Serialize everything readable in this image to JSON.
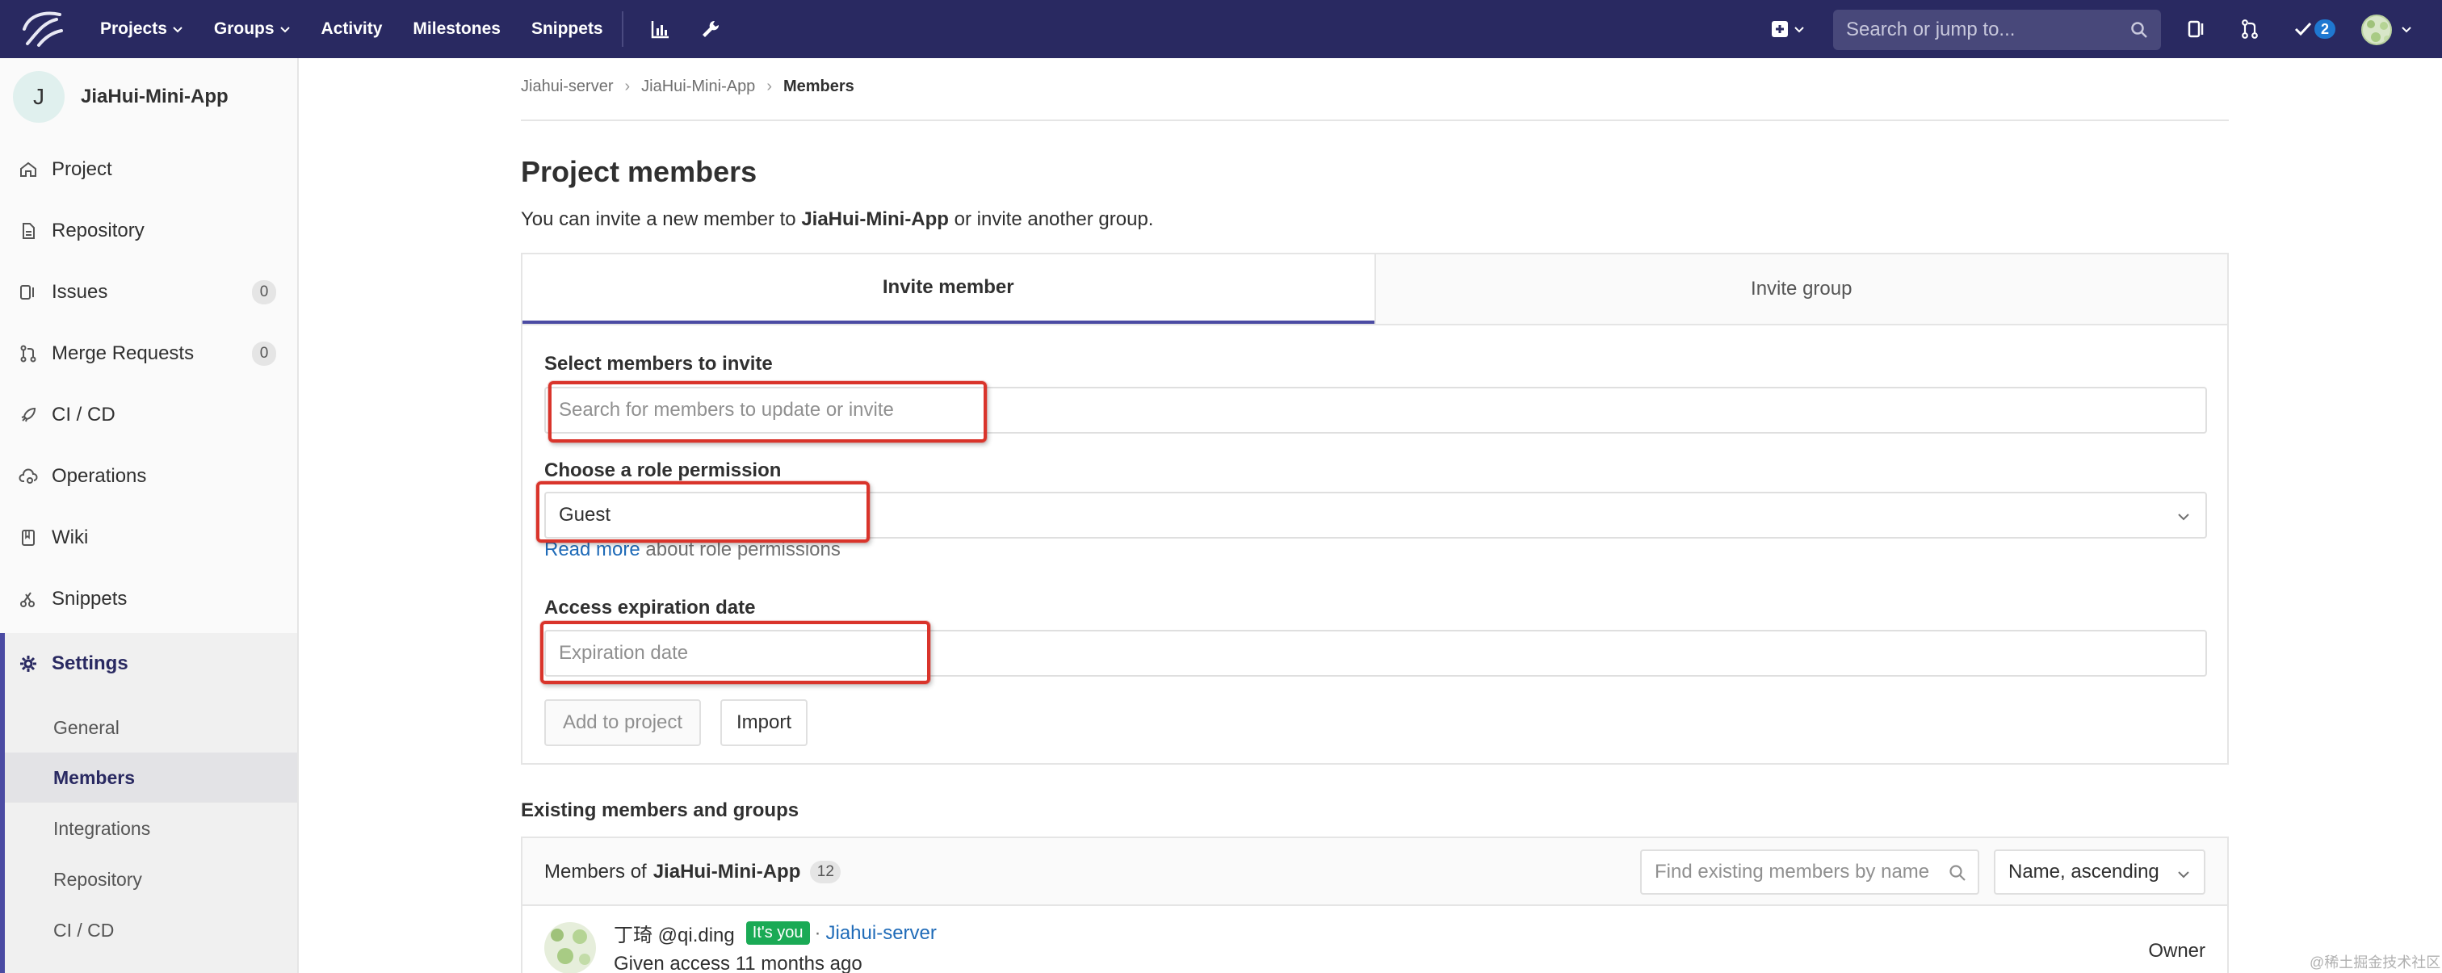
{
  "navbar": {
    "links": [
      "Projects",
      "Groups",
      "Activity",
      "Milestones",
      "Snippets"
    ],
    "search_placeholder": "Search or jump to...",
    "todo_count": "2",
    "colors": {
      "bg": "#292961",
      "accent": "#1f78d1"
    }
  },
  "sidebar": {
    "project_initial": "J",
    "project_name": "JiaHui-Mini-App",
    "items": [
      {
        "label": "Project",
        "icon": "home-icon"
      },
      {
        "label": "Repository",
        "icon": "doc-icon"
      },
      {
        "label": "Issues",
        "icon": "issues-icon",
        "count": "0"
      },
      {
        "label": "Merge Requests",
        "icon": "merge-request-icon",
        "count": "0"
      },
      {
        "label": "CI / CD",
        "icon": "rocket-icon"
      },
      {
        "label": "Operations",
        "icon": "cloud-gear-icon"
      },
      {
        "label": "Wiki",
        "icon": "book-icon"
      },
      {
        "label": "Snippets",
        "icon": "scissors-icon"
      },
      {
        "label": "Settings",
        "icon": "gear-icon"
      }
    ],
    "settings_sub": [
      "General",
      "Members",
      "Integrations",
      "Repository",
      "CI / CD"
    ]
  },
  "breadcrumb": {
    "group": "Jiahui-server",
    "project": "JiaHui-Mini-App",
    "current": "Members"
  },
  "page": {
    "title": "Project members",
    "intro_pre": "You can invite a new member to ",
    "intro_project": "JiaHui-Mini-App",
    "intro_post": " or invite another group."
  },
  "invite": {
    "tab_member": "Invite member",
    "tab_group": "Invite group",
    "select_label": "Select members to invite",
    "select_placeholder": "Search for members to update or invite",
    "role_label": "Choose a role permission",
    "role_value": "Guest",
    "read_more_link": "Read more",
    "read_more_rest": " about role permissions",
    "expiration_label": "Access expiration date",
    "expiration_placeholder": "Expiration date",
    "add_button": "Add to project",
    "import_button": "Import"
  },
  "existing": {
    "title": "Existing members and groups",
    "members_of": "Members of",
    "project": "JiaHui-Mini-App",
    "count": "12",
    "find_placeholder": "Find existing members by name",
    "sort_value": "Name, ascending",
    "member": {
      "name": "丁琦 @qi.ding",
      "badge": "It's you",
      "dot": "·",
      "group": "Jiahui-server",
      "access": "Given access 11 months ago",
      "role": "Owner"
    }
  },
  "watermark": "@稀土掘金技术社区"
}
